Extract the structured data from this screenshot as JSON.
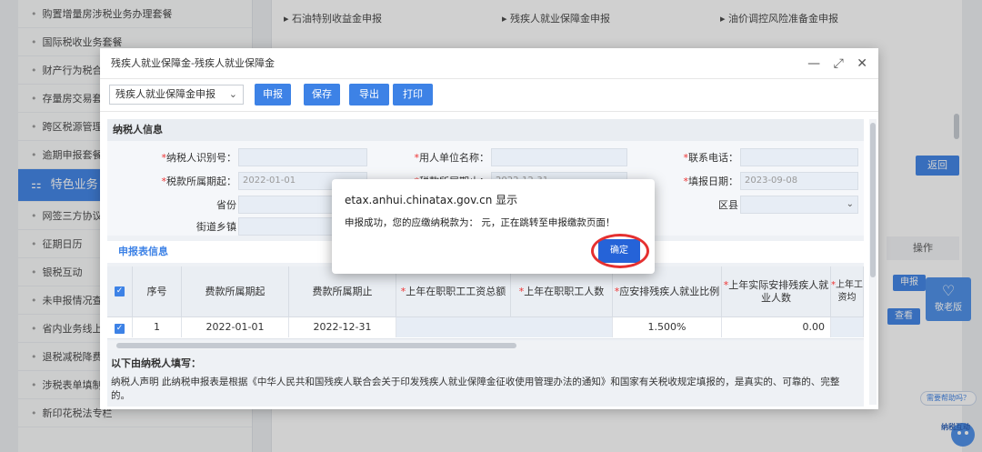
{
  "sidebar": {
    "items": [
      "购置增量房涉税业务办理套餐",
      "国际税收业务套餐",
      "财产行为税合",
      "存量房交易套",
      "跨区税源管理",
      "逾期申报套餐",
      "特色业务",
      "网签三方协议",
      "征期日历",
      "银税互动",
      "未申报情况查",
      "省内业务线上",
      "退税减税降费",
      "涉税表单填制",
      "新印花税法专栏"
    ],
    "active_index": 6
  },
  "top_links": [
    "石油特别收益金申报",
    "残疾人就业保障金申报",
    "油价调控风险准备金申报"
  ],
  "right_panel": {
    "return_label": "返回",
    "op_header": "操作",
    "declare_label": "申报",
    "view_label": "查看",
    "elder_label": "敬老版",
    "help_label": "需要帮助吗？",
    "mascot_text": "纳税互动"
  },
  "modal": {
    "title": "残疾人就业保障金-残疾人就业保障金",
    "toolbar": {
      "select_value": "残疾人就业保障金申报",
      "buttons": [
        "申报",
        "保存",
        "导出",
        "打印"
      ]
    },
    "taxpayer_section": "纳税人信息",
    "fields": {
      "taxpayer_id_label": "纳税人识别号：",
      "employer_name_label": "用人单位名称：",
      "contact_phone_label": "联系电话：",
      "period_start_label": "税款所属期起：",
      "period_start_value": "2022-01-01",
      "period_end_label": "税款所属期止：",
      "period_end_value": "2022-12-31",
      "fill_date_label": "填报日期：",
      "fill_date_value": "2023-09-08",
      "province_label": "省份",
      "district_label": "区县",
      "street_label": "街道乡镇"
    },
    "table_section": "申报表信息",
    "table": {
      "headers": [
        "序号",
        "费款所属期起",
        "费款所属期止",
        "上年在职职工工资总额",
        "上年在职职工人数",
        "应安排残疾人就业比例",
        "上年实际安排残疾人就业人数",
        "上年工资均"
      ],
      "row": {
        "index": "1",
        "start": "2022-01-01",
        "end": "2022-12-31",
        "ratio": "1.500%",
        "disabled_count": "0.00"
      }
    },
    "declaration_title": "以下由纳税人填写：",
    "declaration_text": "纳税人声明  此纳税申报表是根据《中华人民共和国残疾人联合会关于印发残疾人就业保障金征收使用管理办法的通知》和国家有关税收规定填报的，是真实的、可靠的、完整的。"
  },
  "dialog": {
    "title": "etax.anhui.chinatax.gov.cn 显示",
    "message": "申报成功，您的应缴纳税款为：        元，正在跳转至申报缴款页面！",
    "ok_label": "确定"
  }
}
